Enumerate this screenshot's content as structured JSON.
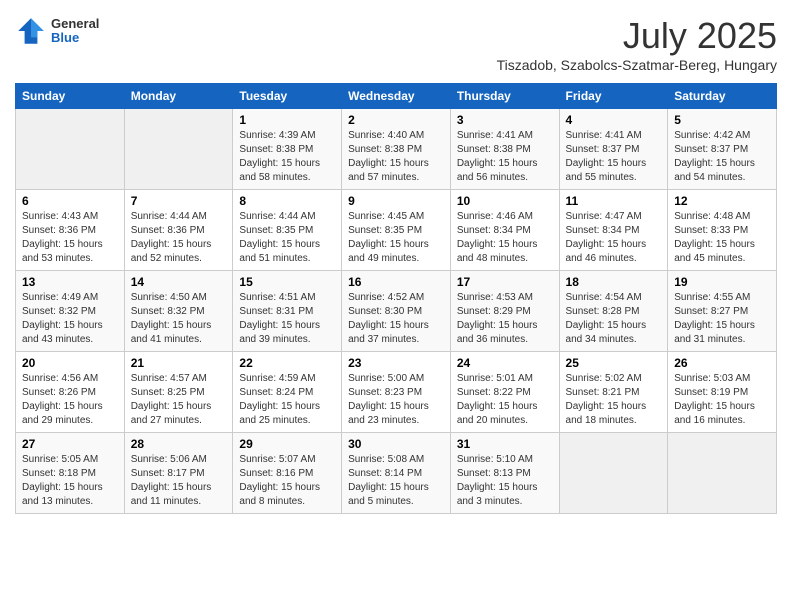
{
  "header": {
    "logo": {
      "general": "General",
      "blue": "Blue"
    },
    "title": "July 2025",
    "location": "Tiszadob, Szabolcs-Szatmar-Bereg, Hungary"
  },
  "weekdays": [
    "Sunday",
    "Monday",
    "Tuesday",
    "Wednesday",
    "Thursday",
    "Friday",
    "Saturday"
  ],
  "weeks": [
    [
      {
        "day": "",
        "info": ""
      },
      {
        "day": "",
        "info": ""
      },
      {
        "day": "1",
        "info": "Sunrise: 4:39 AM\nSunset: 8:38 PM\nDaylight: 15 hours and 58 minutes."
      },
      {
        "day": "2",
        "info": "Sunrise: 4:40 AM\nSunset: 8:38 PM\nDaylight: 15 hours and 57 minutes."
      },
      {
        "day": "3",
        "info": "Sunrise: 4:41 AM\nSunset: 8:38 PM\nDaylight: 15 hours and 56 minutes."
      },
      {
        "day": "4",
        "info": "Sunrise: 4:41 AM\nSunset: 8:37 PM\nDaylight: 15 hours and 55 minutes."
      },
      {
        "day": "5",
        "info": "Sunrise: 4:42 AM\nSunset: 8:37 PM\nDaylight: 15 hours and 54 minutes."
      }
    ],
    [
      {
        "day": "6",
        "info": "Sunrise: 4:43 AM\nSunset: 8:36 PM\nDaylight: 15 hours and 53 minutes."
      },
      {
        "day": "7",
        "info": "Sunrise: 4:44 AM\nSunset: 8:36 PM\nDaylight: 15 hours and 52 minutes."
      },
      {
        "day": "8",
        "info": "Sunrise: 4:44 AM\nSunset: 8:35 PM\nDaylight: 15 hours and 51 minutes."
      },
      {
        "day": "9",
        "info": "Sunrise: 4:45 AM\nSunset: 8:35 PM\nDaylight: 15 hours and 49 minutes."
      },
      {
        "day": "10",
        "info": "Sunrise: 4:46 AM\nSunset: 8:34 PM\nDaylight: 15 hours and 48 minutes."
      },
      {
        "day": "11",
        "info": "Sunrise: 4:47 AM\nSunset: 8:34 PM\nDaylight: 15 hours and 46 minutes."
      },
      {
        "day": "12",
        "info": "Sunrise: 4:48 AM\nSunset: 8:33 PM\nDaylight: 15 hours and 45 minutes."
      }
    ],
    [
      {
        "day": "13",
        "info": "Sunrise: 4:49 AM\nSunset: 8:32 PM\nDaylight: 15 hours and 43 minutes."
      },
      {
        "day": "14",
        "info": "Sunrise: 4:50 AM\nSunset: 8:32 PM\nDaylight: 15 hours and 41 minutes."
      },
      {
        "day": "15",
        "info": "Sunrise: 4:51 AM\nSunset: 8:31 PM\nDaylight: 15 hours and 39 minutes."
      },
      {
        "day": "16",
        "info": "Sunrise: 4:52 AM\nSunset: 8:30 PM\nDaylight: 15 hours and 37 minutes."
      },
      {
        "day": "17",
        "info": "Sunrise: 4:53 AM\nSunset: 8:29 PM\nDaylight: 15 hours and 36 minutes."
      },
      {
        "day": "18",
        "info": "Sunrise: 4:54 AM\nSunset: 8:28 PM\nDaylight: 15 hours and 34 minutes."
      },
      {
        "day": "19",
        "info": "Sunrise: 4:55 AM\nSunset: 8:27 PM\nDaylight: 15 hours and 31 minutes."
      }
    ],
    [
      {
        "day": "20",
        "info": "Sunrise: 4:56 AM\nSunset: 8:26 PM\nDaylight: 15 hours and 29 minutes."
      },
      {
        "day": "21",
        "info": "Sunrise: 4:57 AM\nSunset: 8:25 PM\nDaylight: 15 hours and 27 minutes."
      },
      {
        "day": "22",
        "info": "Sunrise: 4:59 AM\nSunset: 8:24 PM\nDaylight: 15 hours and 25 minutes."
      },
      {
        "day": "23",
        "info": "Sunrise: 5:00 AM\nSunset: 8:23 PM\nDaylight: 15 hours and 23 minutes."
      },
      {
        "day": "24",
        "info": "Sunrise: 5:01 AM\nSunset: 8:22 PM\nDaylight: 15 hours and 20 minutes."
      },
      {
        "day": "25",
        "info": "Sunrise: 5:02 AM\nSunset: 8:21 PM\nDaylight: 15 hours and 18 minutes."
      },
      {
        "day": "26",
        "info": "Sunrise: 5:03 AM\nSunset: 8:19 PM\nDaylight: 15 hours and 16 minutes."
      }
    ],
    [
      {
        "day": "27",
        "info": "Sunrise: 5:05 AM\nSunset: 8:18 PM\nDaylight: 15 hours and 13 minutes."
      },
      {
        "day": "28",
        "info": "Sunrise: 5:06 AM\nSunset: 8:17 PM\nDaylight: 15 hours and 11 minutes."
      },
      {
        "day": "29",
        "info": "Sunrise: 5:07 AM\nSunset: 8:16 PM\nDaylight: 15 hours and 8 minutes."
      },
      {
        "day": "30",
        "info": "Sunrise: 5:08 AM\nSunset: 8:14 PM\nDaylight: 15 hours and 5 minutes."
      },
      {
        "day": "31",
        "info": "Sunrise: 5:10 AM\nSunset: 8:13 PM\nDaylight: 15 hours and 3 minutes."
      },
      {
        "day": "",
        "info": ""
      },
      {
        "day": "",
        "info": ""
      }
    ]
  ]
}
